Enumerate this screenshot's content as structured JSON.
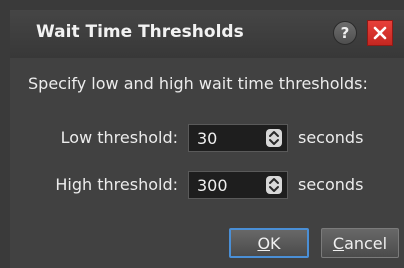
{
  "dialog": {
    "title": "Wait Time Thresholds",
    "help_symbol": "?",
    "instruction": "Specify low and high wait time thresholds:",
    "low": {
      "label": "Low threshold:",
      "value": "30",
      "unit": "seconds"
    },
    "high": {
      "label": "High threshold:",
      "value": "300",
      "unit": "seconds"
    },
    "ok": {
      "mnemonic": "O",
      "rest": "K"
    },
    "cancel": {
      "mnemonic": "C",
      "rest": "ancel"
    }
  },
  "colors": {
    "titlebar": "#3d3d3d",
    "body": "#414141",
    "close": "#d32f2a",
    "ok_border": "#4a8fd6"
  },
  "icons": {
    "help": "question-mark-icon",
    "close": "close-x-icon",
    "spinner": "up-down-arrows-icon"
  }
}
